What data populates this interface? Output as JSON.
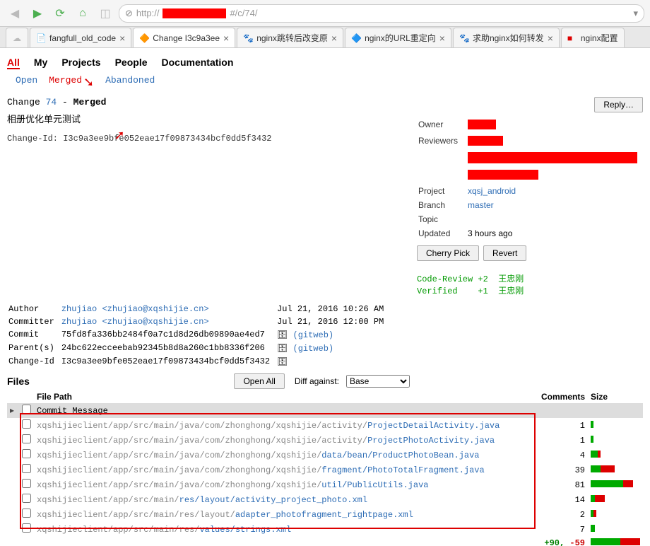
{
  "url_visible": "http://",
  "url_fragment": "#/c/74/",
  "tabs": [
    {
      "title": "fangfull_old_code"
    },
    {
      "title": "Change I3c9a3ee"
    },
    {
      "title": "nginx跳转后改变原"
    },
    {
      "title": "nginx的URL重定向"
    },
    {
      "title": "求助nginx如何转发"
    },
    {
      "title": "nginx配置"
    }
  ],
  "top_menu": {
    "all": "All",
    "my": "My",
    "projects": "Projects",
    "people": "People",
    "documentation": "Documentation"
  },
  "sub_menu": {
    "open": "Open",
    "merged": "Merged",
    "abandoned": "Abandoned"
  },
  "change": {
    "label": "Change",
    "number": "74",
    "sep": "-",
    "status": "Merged",
    "title": "相册优化单元测试",
    "id_label": "Change-Id:",
    "id": "I3c9a3ee9bfe052eae17f09873434bcf0dd5f3432"
  },
  "reply_btn": "Reply…",
  "meta": {
    "owner_label": "Owner",
    "reviewers_label": "Reviewers",
    "project_label": "Project",
    "project": "xqsj_android",
    "branch_label": "Branch",
    "branch": "master",
    "topic_label": "Topic",
    "updated_label": "Updated",
    "updated": "3 hours ago"
  },
  "actions": {
    "cherry_pick": "Cherry Pick",
    "revert": "Revert"
  },
  "review": {
    "code_review_label": "Code-Review",
    "code_review_score": "+2",
    "code_review_user": "王忠刚",
    "verified_label": "Verified",
    "verified_score": "+1",
    "verified_user": "王忠刚"
  },
  "commit": {
    "author_label": "Author",
    "author_name": "zhujiao",
    "author_email": "<zhujiao@xqshijie.cn>",
    "author_date": "Jul 21, 2016 10:26 AM",
    "committer_label": "Committer",
    "committer_name": "zhujiao",
    "committer_email": "<zhujiao@xqshijie.cn>",
    "committer_date": "Jul 21, 2016 12:00 PM",
    "commit_label": "Commit",
    "commit_hash": "75fd8fa336bb2484f0a7c1d8d26db09890ae4ed7",
    "gitweb": "(gitweb)",
    "parent_label": "Parent(s)",
    "parent_hash": "24bc622ecceebab92345b8d8a260c1bb8336f206",
    "change_id_label": "Change-Id",
    "change_id": "I3c9a3ee9bfe052eae17f09873434bcf0dd5f3432"
  },
  "files_section": {
    "title": "Files",
    "open_all": "Open All",
    "diff_against": "Diff against:",
    "base_option": "Base",
    "th_file_path": "File Path",
    "th_comments": "Comments",
    "th_size": "Size",
    "commit_message": "Commit Message"
  },
  "files": [
    {
      "prefix": "xqshijieclient/app/src/main/java/com/zhonghong/xqshijie/activity/",
      "name": "ProjectDetailActivity.java",
      "comments": "1",
      "g": 4,
      "r": 0
    },
    {
      "prefix": "xqshijieclient/app/src/main/java/com/zhonghong/xqshijie/activity/",
      "name": "ProjectPhotoActivity.java",
      "comments": "1",
      "g": 4,
      "r": 0
    },
    {
      "prefix": "xqshijieclient/app/src/main/java/com/zhonghong/xqshijie/",
      "name": "data/bean/ProductPhotoBean.java",
      "comments": "4",
      "g": 10,
      "r": 4
    },
    {
      "prefix": "xqshijieclient/app/src/main/java/com/zhonghong/xqshijie/",
      "name": "fragment/PhotoTotalFragment.java",
      "comments": "39",
      "g": 14,
      "r": 20
    },
    {
      "prefix": "xqshijieclient/app/src/main/java/com/zhonghong/xqshijie/",
      "name": "util/PublicUtils.java",
      "comments": "81",
      "g": 46,
      "r": 14
    },
    {
      "prefix": "xqshijieclient/app/src/main/",
      "name": "res/layout/activity_project_photo.xml",
      "comments": "14",
      "g": 6,
      "r": 14
    },
    {
      "prefix": "xqshijieclient/app/src/main/res/layout/",
      "name": "adapter_photofragment_rightpage.xml",
      "comments": "2",
      "g": 4,
      "r": 4
    },
    {
      "prefix": "xqshijieclient/app/src/main/res/",
      "name": "values/strings.xml",
      "comments": "7",
      "g": 6,
      "r": 0
    }
  ],
  "totals": {
    "plus": "+90,",
    "minus": "-59"
  }
}
